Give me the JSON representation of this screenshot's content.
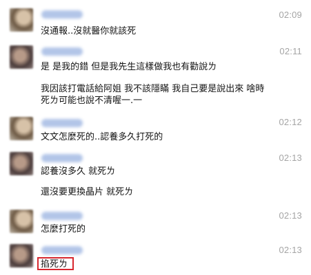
{
  "chat": {
    "groups": [
      {
        "time": "02:09",
        "messages": [
          "沒通報..沒就醫你就該死"
        ]
      },
      {
        "time": "02:11",
        "messages": [
          "是 是我的錯 但是我先生這樣做我也有勸說ㄌ",
          "我因該打電話給阿姐 我不該隱瞞 我自己要是說出來 啥時死ㄌ可能也說不清喔一.一"
        ]
      },
      {
        "time": "02:12",
        "messages": [
          "文文怎麼死的..認養多久打死的"
        ]
      },
      {
        "time": "02:13",
        "messages": [
          "認養沒多久 就死ㄌ",
          "還沒要更換晶片 就死ㄌ"
        ]
      },
      {
        "time": "02:13",
        "messages": [
          "怎麼打死的"
        ]
      },
      {
        "time": "02:13",
        "messages": [
          "掐死ㄌ"
        ]
      }
    ]
  },
  "colors": {
    "highlight_border": "#d7262e",
    "timestamp_text": "#a4a4a4",
    "message_text": "#141414"
  }
}
